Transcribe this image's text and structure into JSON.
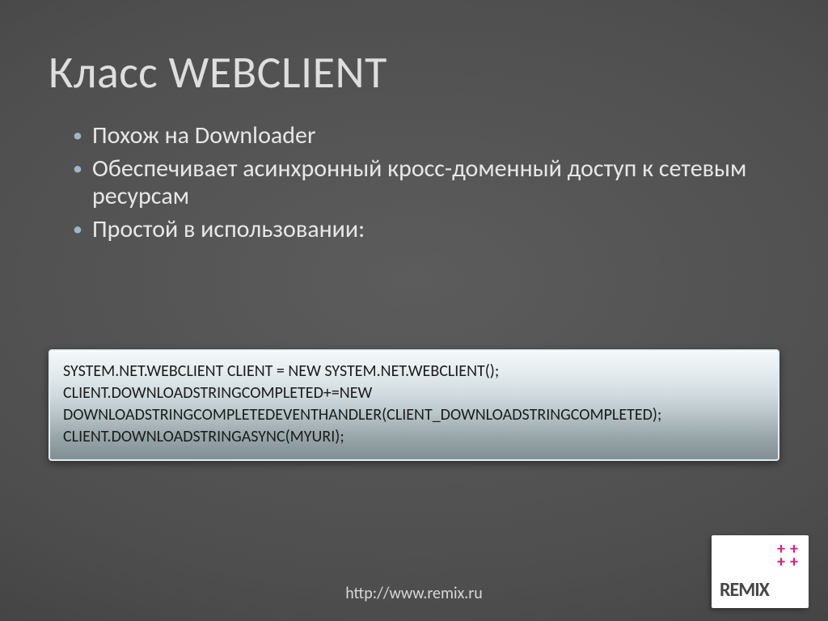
{
  "title": "Класс WEBCLIENT",
  "bullets": [
    "Похож на Downloader",
    "Обеспечивает асинхронный кросс-доменный доступ к сетевым ресурсам",
    "Простой в использовании:"
  ],
  "code_lines": [
    "SYSTEM.NET.WEBCLIENT CLIENT = NEW SYSTEM.NET.WEBCLIENT();",
    "CLIENT.DOWNLOADSTRINGCOMPLETED+=NEW",
    "DOWNLOADSTRINGCOMPLETEDEVENTHANDLER(CLIENT_DOWNLOADSTRINGCOMPLETED);",
    "CLIENT.DOWNLOADSTRINGASYNC(MYURI);"
  ],
  "footer": "http://www.remix.ru",
  "logo": {
    "brand": "REMIX",
    "plus": "+"
  }
}
